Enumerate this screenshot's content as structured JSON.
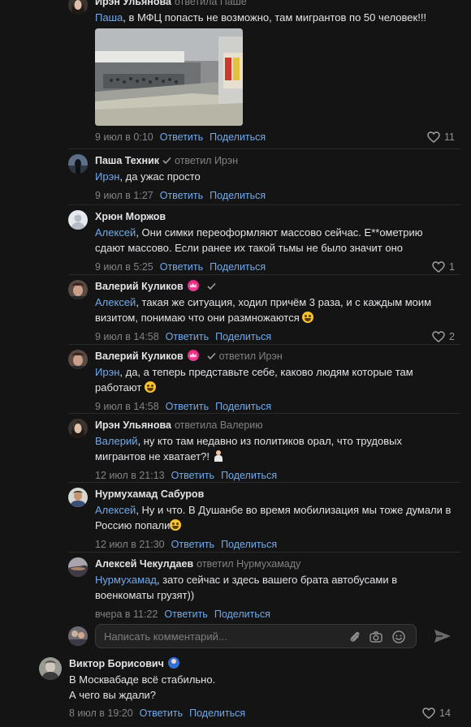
{
  "comments": [
    {
      "author": "Ирэн Ульянова",
      "replied": "ответила Паше",
      "mention": "Паша",
      "text": ", в МФЦ попасть не возможно, там мигрантов по 50 человек!!!",
      "date": "9 июл в 0:10",
      "likes": "11"
    },
    {
      "author": "Паша Техник",
      "replied": "ответил Ирэн",
      "mention": "Ирэн",
      "text": ", да ужас просто",
      "date": "9 июл в 1:27",
      "likes": ""
    },
    {
      "author": "Хрюн Моржов",
      "replied": "",
      "mention": "Алексей",
      "text": ", Они симки переоформляют массово сейчас. Е**ометрию сдают массово. Если ранее их такой тьмы не было значит оно",
      "date": "9 июл в 5:25",
      "likes": "1"
    },
    {
      "author": "Валерий Куликов",
      "replied": "",
      "mention": "Алексей",
      "text": ", такая же ситуация, ходил причём 3 раза, и с каждым моим визитом, понимаю что они размножаются ",
      "date": "9 июл в 14:58",
      "likes": "2"
    },
    {
      "author": "Валерий Куликов",
      "replied": "ответил Ирэн",
      "mention": "Ирэн",
      "text": ", да, а теперь представьте себе, каково людям которые там работают ",
      "date": "9 июл в 14:58",
      "likes": ""
    },
    {
      "author": "Ирэн Ульянова",
      "replied": "ответила Валерию",
      "mention": "Валерий",
      "text": ", ну кто там недавно из политиков орал, что трудовых мигрантов не хватает?! ",
      "date": "12 июл в 21:13",
      "likes": ""
    },
    {
      "author": "Нурмухамад Сабуров",
      "replied": "",
      "mention": "Алексей",
      "text": ", Ну и что. В Душанбе во время мобилизация мы тоже думали в Россию попали",
      "date": "12 июл в 21:30",
      "likes": ""
    },
    {
      "author": "Алексей Чекулдаев",
      "replied": "ответил Нурмухамаду",
      "mention": "Нурмухамад",
      "text": ", зато сейчас и здесь вашего брата автобусами в военкоматы грузят))",
      "date": "вчера в 11:22",
      "likes": ""
    }
  ],
  "actions": {
    "reply": "Ответить",
    "share": "Поделиться"
  },
  "composer": {
    "placeholder": "Написать комментарий..."
  },
  "root_comment": {
    "author": "Виктор Борисович",
    "line1": "В Москвабаде всё стабильно.",
    "line2": "А чего вы ждали?",
    "date": "8 июл в 19:20",
    "likes": "14"
  },
  "colors": {
    "background": "#141414",
    "link": "#71aaeb",
    "text": "#e1e3e6",
    "muted": "#828282"
  }
}
